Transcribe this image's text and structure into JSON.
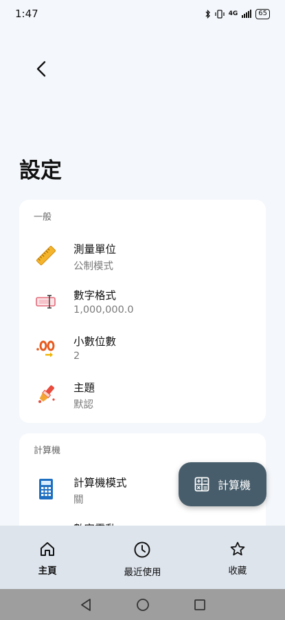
{
  "status": {
    "time": "1:47",
    "network": "4G",
    "battery": "65"
  },
  "page": {
    "title": "設定"
  },
  "general": {
    "label": "一般",
    "items": [
      {
        "title": "測量單位",
        "value": "公制模式",
        "icon": "ruler-icon"
      },
      {
        "title": "數字格式",
        "value": "1,000,000.0",
        "icon": "number-format-icon"
      },
      {
        "title": "小數位數",
        "value": "2",
        "icon": "decimal-places-icon"
      },
      {
        "title": "主題",
        "value": "默認",
        "icon": "paint-brush-icon"
      }
    ]
  },
  "calculator": {
    "label": "計算機",
    "items": [
      {
        "title": "計算機模式",
        "value": "關",
        "icon": "calculator-icon"
      },
      {
        "title": "數字震動",
        "value": "",
        "icon": "vibration-icon"
      }
    ]
  },
  "fab": {
    "label": "計算機",
    "icon": "calculator-icon"
  },
  "bottom_nav": [
    {
      "label": "主頁",
      "icon": "home-icon"
    },
    {
      "label": "最近使用",
      "icon": "clock-icon"
    },
    {
      "label": "收藏",
      "icon": "star-icon"
    }
  ],
  "colors": {
    "background": "#f4f7fb",
    "fab": "#475d6b",
    "nav": "#dde4ec",
    "system_nav": "#9e9e9e"
  }
}
